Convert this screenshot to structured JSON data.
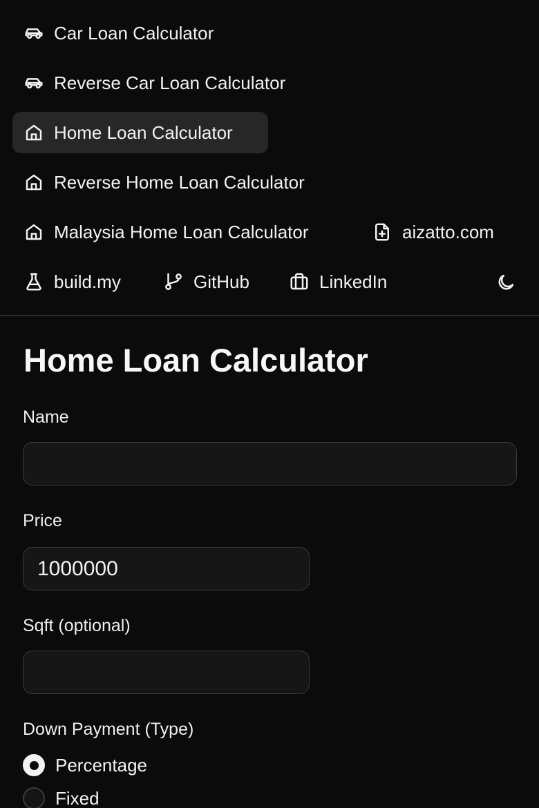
{
  "nav": {
    "car_loan": {
      "label": "Car Loan Calculator",
      "icon": "car-icon"
    },
    "reverse_car_loan": {
      "label": "Reverse Car Loan Calculator",
      "icon": "car-icon"
    },
    "home_loan": {
      "label": "Home Loan Calculator",
      "icon": "house-icon",
      "active": true
    },
    "reverse_home_loan": {
      "label": "Reverse Home Loan Calculator",
      "icon": "house-icon"
    },
    "malaysia_home_loan": {
      "label": "Malaysia Home Loan Calculator",
      "icon": "house-icon"
    },
    "aizatto": {
      "label": "aizatto.com",
      "icon": "file-plus-icon"
    },
    "build_my": {
      "label": "build.my",
      "icon": "flask-icon"
    },
    "github": {
      "label": "GitHub",
      "icon": "git-branch-icon"
    },
    "linkedin": {
      "label": "LinkedIn",
      "icon": "briefcase-icon"
    },
    "theme_toggle": {
      "icon": "moon-icon"
    }
  },
  "page": {
    "title": "Home Loan Calculator"
  },
  "form": {
    "name": {
      "label": "Name",
      "value": "",
      "placeholder": ""
    },
    "price": {
      "label": "Price",
      "value": "1000000"
    },
    "sqft": {
      "label": "Sqft (optional)",
      "value": ""
    },
    "down_payment_type": {
      "label": "Down Payment (Type)",
      "options": [
        "Percentage",
        "Fixed"
      ],
      "selected": "Percentage"
    }
  },
  "colors": {
    "background": "#0b0b0b",
    "active_nav": "#272727",
    "input_background": "#161616",
    "input_border": "#3a3a3a",
    "text": "#f2f2f2"
  }
}
